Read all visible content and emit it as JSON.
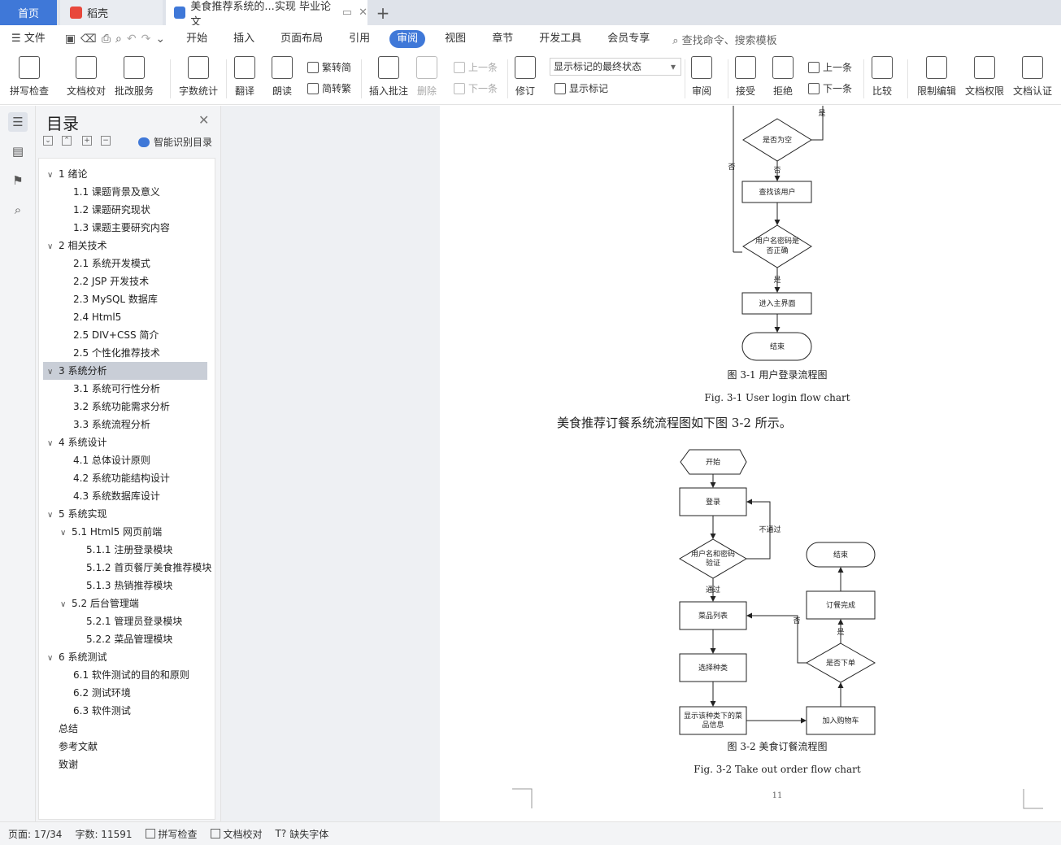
{
  "tabs": {
    "home": "首页",
    "daoke": "稻壳",
    "doc": "美食推荐系统的...实现 毕业论文"
  },
  "menu": [
    "文件",
    "开始",
    "插入",
    "页面布局",
    "引用",
    "审阅",
    "视图",
    "章节",
    "开发工具",
    "会员专享"
  ],
  "active_menu": "审阅",
  "search_cmd": "查找命令、搜索模板",
  "ribbon": {
    "spell": "拼写检查",
    "proof": "文档校对",
    "batch": "批改服务",
    "wordcount": "字数统计",
    "translate": "翻译",
    "read": "朗读",
    "t2s": "繁转简",
    "s2t": "简转繁",
    "insert_comment": "插入批注",
    "delete": "删除",
    "prev_comment": "上一条",
    "next_comment": "下一条",
    "track": "修订",
    "markup_state": "显示标记的最终状态",
    "show_markup": "显示标记",
    "review": "审阅",
    "accept": "接受",
    "reject": "拒绝",
    "prev_change": "上一条",
    "next_change": "下一条",
    "compare": "比较",
    "restrict": "限制编辑",
    "permission": "文档权限",
    "certify": "文档认证"
  },
  "toc": {
    "title": "目录",
    "smart": "智能识别目录",
    "items": [
      {
        "label": "1 绪论",
        "level": 1,
        "arrow": "∨"
      },
      {
        "label": "1.1 课题背景及意义",
        "level": 2
      },
      {
        "label": "1.2 课题研究现状",
        "level": 2
      },
      {
        "label": "1.3 课题主要研究内容",
        "level": 2
      },
      {
        "label": "2 相关技术",
        "level": 1,
        "arrow": "∨"
      },
      {
        "label": "2.1 系统开发模式",
        "level": 2
      },
      {
        "label": "2.2 JSP 开发技术",
        "level": 2
      },
      {
        "label": "2.3 MySQL 数据库",
        "level": 2
      },
      {
        "label": "2.4 Html5",
        "level": 2
      },
      {
        "label": "2.5 DIV+CSS 简介",
        "level": 2
      },
      {
        "label": "2.5 个性化推荐技术",
        "level": 2
      },
      {
        "label": "3 系统分析",
        "level": 1,
        "arrow": "∨",
        "selected": true
      },
      {
        "label": "3.1 系统可行性分析",
        "level": 2
      },
      {
        "label": "3.2 系统功能需求分析",
        "level": 2
      },
      {
        "label": "3.3 系统流程分析",
        "level": 2
      },
      {
        "label": "4 系统设计",
        "level": 1,
        "arrow": "∨"
      },
      {
        "label": "4.1 总体设计原则",
        "level": 2
      },
      {
        "label": "4.2 系统功能结构设计",
        "level": 2
      },
      {
        "label": "4.3 系统数据库设计",
        "level": 2
      },
      {
        "label": "5  系统实现",
        "level": 1,
        "arrow": "∨"
      },
      {
        "label": "5.1 Html5 网页前端",
        "level": 2,
        "arrow": "∨"
      },
      {
        "label": "5.1.1 注册登录模块",
        "level": 3
      },
      {
        "label": "5.1.2 首页餐厅美食推荐模块",
        "level": 3
      },
      {
        "label": "5.1.3 热销推荐模块",
        "level": 3
      },
      {
        "label": "5.2 后台管理端",
        "level": 2,
        "arrow": "∨"
      },
      {
        "label": "5.2.1 管理员登录模块",
        "level": 3
      },
      {
        "label": "5.2.2 菜品管理模块",
        "level": 3
      },
      {
        "label": "6  系统测试",
        "level": 1,
        "arrow": "∨"
      },
      {
        "label": "6.1  软件测试的目的和原则",
        "level": 2
      },
      {
        "label": "6.2  测试环境",
        "level": 2
      },
      {
        "label": "6.3  软件测试",
        "level": 2
      },
      {
        "label": "总结",
        "level": 1
      },
      {
        "label": "参考文献",
        "level": 1
      },
      {
        "label": "致谢",
        "level": 1
      }
    ]
  },
  "doc": {
    "fc1": {
      "is_empty": "是否为空",
      "yes1": "是",
      "no1": "否",
      "no_left": "否",
      "find_user": "查找该用户",
      "pw_correct_1": "用户名密码是",
      "pw_correct_2": "否正确",
      "yes2": "是",
      "enter_main": "进入主界面",
      "end": "结束",
      "caption_cn": "图 3-1  用户登录流程图",
      "caption_en": "Fig. 3-1 User login flow chart"
    },
    "body_text": "美食推荐订餐系统流程图如下图 3-2 所示。",
    "fc2": {
      "start": "开始",
      "login": "登录",
      "fail": "不通过",
      "verify_1": "用户名和密码",
      "verify_2": "验证",
      "pass": "通过",
      "dish_list": "菜品列表",
      "choose_type": "选择种类",
      "show_1": "显示该种类下的菜",
      "show_2": "品信息",
      "add_cart": "加入购物车",
      "is_order": "是否下单",
      "no": "否",
      "yes": "是",
      "order_done": "订餐完成",
      "end": "结束",
      "caption_cn": "图 3-2  美食订餐流程图",
      "caption_en": "Fig. 3-2 Take out order flow chart"
    },
    "page_number": "11"
  },
  "status": {
    "page": "页面: 17/34",
    "words": "字数: 11591",
    "spell": "拼写检查",
    "proof": "文档校对",
    "missing_font": "缺失字体"
  },
  "colors": {
    "accent": "#3f78d8",
    "workspace": "#eef0f3"
  }
}
